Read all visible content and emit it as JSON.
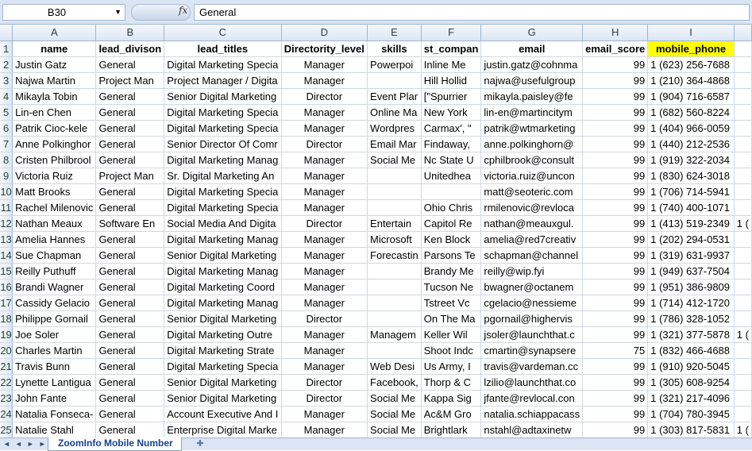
{
  "formula_bar": {
    "name_box": "B30",
    "name_box_icon": "chevron-down-icon",
    "fx_label": "fx",
    "formula": "General"
  },
  "columns": [
    "A",
    "B",
    "C",
    "D",
    "E",
    "F",
    "G",
    "H",
    "I"
  ],
  "header_row": {
    "row_number": "1",
    "cells": [
      "name",
      "lead_divison",
      "lead_titles",
      "Directority_level",
      "skills",
      "st_compan",
      "email",
      "email_score",
      "mobile_phone"
    ]
  },
  "rows": [
    {
      "n": "2",
      "cells": [
        "Justin Gatz",
        "General",
        "Digital Marketing Specia",
        "Manager",
        "Powerpoi",
        "Inline Me",
        "justin.gatz@cohnma",
        "99",
        "1 (623) 256-7688",
        ""
      ]
    },
    {
      "n": "3",
      "cells": [
        "Najwa Martin",
        "Project Man",
        "Project Manager / Digita",
        "Manager",
        "",
        "Hill Hollid",
        "najwa@usefulgroup",
        "99",
        "1 (210) 364-4868",
        ""
      ]
    },
    {
      "n": "4",
      "cells": [
        "Mikayla Tobin",
        "General",
        "Senior Digital Marketing",
        "Director",
        "Event Plar",
        "[\"Spurrier",
        "mikayla.paisley@fe",
        "99",
        "1 (904) 716-6587",
        ""
      ]
    },
    {
      "n": "5",
      "cells": [
        "Lin-en Chen",
        "General",
        "Digital Marketing Specia",
        "Manager",
        "Online Ma",
        "New York",
        "lin-en@martincitym",
        "99",
        "1 (682) 560-8224",
        ""
      ]
    },
    {
      "n": "6",
      "cells": [
        "Patrik Cioc-kele",
        "General",
        "Digital Marketing Specia",
        "Manager",
        "Wordpres",
        "Carmax', \"",
        "patrik@wtmarketing",
        "99",
        "1 (404) 966-0059",
        ""
      ]
    },
    {
      "n": "7",
      "cells": [
        "Anne Polkinghor",
        "General",
        "Senior Director Of Comr",
        "Director",
        "Email Mar",
        "Findaway,",
        "anne.polkinghorn@",
        "99",
        "1 (440) 212-2536",
        ""
      ]
    },
    {
      "n": "8",
      "cells": [
        "Cristen Philbrool",
        "General",
        "Digital Marketing Manag",
        "Manager",
        "Social Me",
        "Nc State U",
        "cphilbrook@consult",
        "99",
        "1 (919) 322-2034",
        ""
      ]
    },
    {
      "n": "9",
      "cells": [
        "Victoria Ruiz",
        "Project Man",
        "Sr. Digital Marketing An",
        "Manager",
        "",
        "Unitedhea",
        "victoria.ruiz@uncon",
        "99",
        "1 (830) 624-3018",
        ""
      ]
    },
    {
      "n": "10",
      "cells": [
        "Matt Brooks",
        "General",
        "Digital Marketing Specia",
        "Manager",
        "",
        "",
        "matt@seoteric.com",
        "99",
        "1 (706) 714-5941",
        ""
      ]
    },
    {
      "n": "11",
      "cells": [
        "Rachel Milenovic",
        "General",
        "Digital Marketing Specia",
        "Manager",
        "",
        "Ohio Chris",
        "rmilenovic@revloca",
        "99",
        "1 (740) 400-1071",
        ""
      ]
    },
    {
      "n": "12",
      "cells": [
        "Nathan Meaux",
        "Software En",
        "Social Media And Digita",
        "Director",
        "Entertain",
        "Capitol Re",
        "nathan@meauxgul.",
        "99",
        "1 (413) 519-2349",
        "1 ("
      ]
    },
    {
      "n": "13",
      "cells": [
        "Amelia Hannes",
        "General",
        "Digital Marketing Manag",
        "Manager",
        "Microsoft",
        "Ken Block",
        "amelia@red7creativ",
        "99",
        "1 (202) 294-0531",
        ""
      ]
    },
    {
      "n": "14",
      "cells": [
        "Sue Chapman",
        "General",
        "Senior Digital Marketing",
        "Manager",
        "Forecastin",
        "Parsons Te",
        "schapman@channel",
        "99",
        "1 (319) 631-9937",
        ""
      ]
    },
    {
      "n": "15",
      "cells": [
        "Reilly Puthuff",
        "General",
        "Digital Marketing Manag",
        "Manager",
        "",
        "Brandy Me",
        "reilly@wip.fyi",
        "99",
        "1 (949) 637-7504",
        ""
      ]
    },
    {
      "n": "16",
      "cells": [
        "Brandi Wagner",
        "General",
        "Digital Marketing Coord",
        "Manager",
        "",
        "Tucson Ne",
        "bwagner@octanem",
        "99",
        "1 (951) 386-9809",
        ""
      ]
    },
    {
      "n": "17",
      "cells": [
        "Cassidy Gelacio",
        "General",
        "Digital Marketing Manag",
        "Manager",
        "",
        "Tstreet Vc",
        "cgelacio@nessieme",
        "99",
        "1 (714) 412-1720",
        ""
      ]
    },
    {
      "n": "18",
      "cells": [
        "Philippe Gornail",
        "General",
        "Senior Digital Marketing",
        "Director",
        "",
        "On The Ma",
        "pgornail@highervis",
        "99",
        "1 (786) 328-1052",
        ""
      ]
    },
    {
      "n": "19",
      "cells": [
        "Joe Soler",
        "General",
        "Digital Marketing Outre",
        "Manager",
        "Managem",
        "Keller Wil",
        "jsoler@launchthat.c",
        "99",
        "1 (321) 377-5878",
        "1 ("
      ]
    },
    {
      "n": "20",
      "cells": [
        "Charles Martin",
        "General",
        "Digital Marketing Strate",
        "Manager",
        "",
        "Shoot Indc",
        "cmartin@synapsere",
        "75",
        "1 (832) 466-4688",
        ""
      ]
    },
    {
      "n": "21",
      "cells": [
        "Travis Bunn",
        "General",
        "Digital Marketing Specia",
        "Manager",
        "Web Desi",
        "Us Army, I",
        "travis@vardeman.cc",
        "99",
        "1 (910) 920-5045",
        ""
      ]
    },
    {
      "n": "22",
      "cells": [
        "Lynette Lantigua",
        "General",
        "Senior Digital Marketing",
        "Director",
        "Facebook,",
        "Thorp & C",
        "lzilio@launchthat.co",
        "99",
        "1 (305) 608-9254",
        ""
      ]
    },
    {
      "n": "23",
      "cells": [
        "John Fante",
        "General",
        "Senior Digital Marketing",
        "Director",
        "Social Me",
        "Kappa Sig",
        "jfante@revlocal.con",
        "99",
        "1 (321) 217-4096",
        ""
      ]
    },
    {
      "n": "24",
      "cells": [
        "Natalia Fonseca-",
        "General",
        "Account Executive And I",
        "Manager",
        "Social Me",
        "Ac&M Gro",
        "natalia.schiappacass",
        "99",
        "1 (704) 780-3945",
        ""
      ]
    },
    {
      "n": "25",
      "cells": [
        "Natalie Stahl",
        "General",
        "Enterprise Digital Marke",
        "Manager",
        "Social Me",
        "Brightlark",
        "nstahl@adtaxinetw",
        "99",
        "1 (303) 817-5831",
        "1 ("
      ]
    }
  ],
  "sheet_tab": {
    "label": "ZoomInfo Mobile Number",
    "new_tab_icon": "insert-sheet-icon",
    "nav_icons": [
      "first-sheet-icon",
      "prev-sheet-icon",
      "next-sheet-icon",
      "last-sheet-icon"
    ]
  },
  "colors": {
    "highlight": "#ffff00",
    "header_bg": "#dce6f4",
    "grid_line": "#d0d7e5"
  }
}
